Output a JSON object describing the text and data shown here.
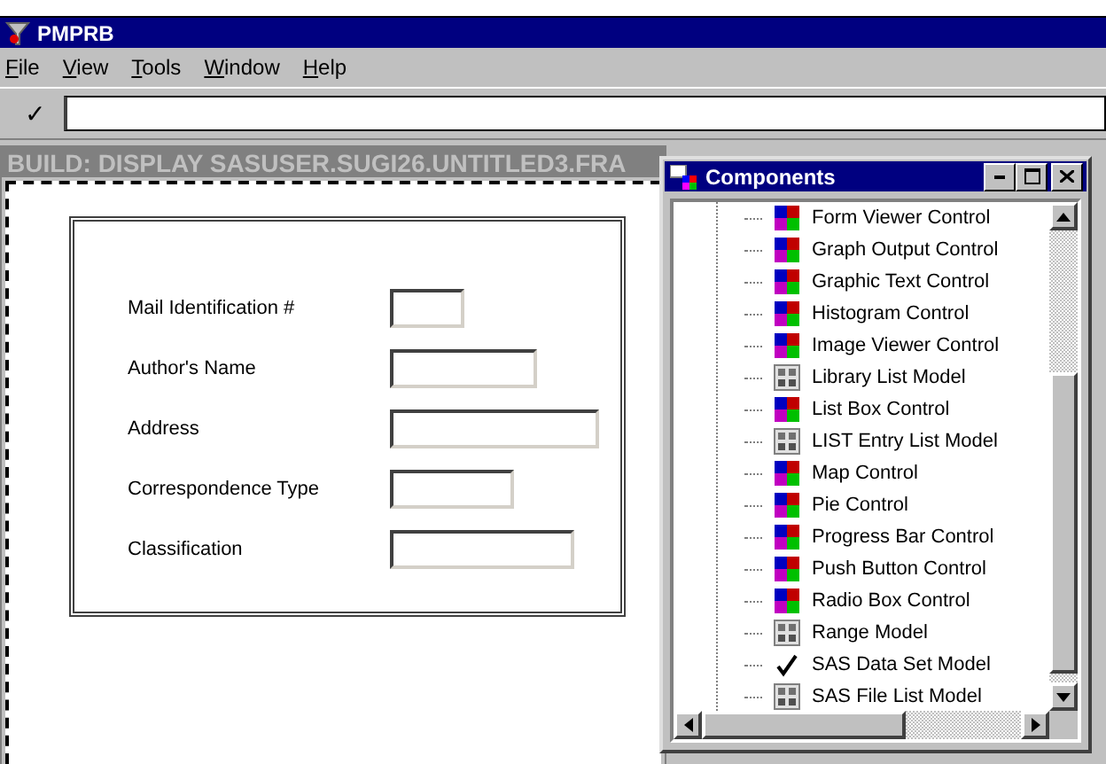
{
  "window": {
    "title": "PMPRB"
  },
  "menu": [
    {
      "label": "File"
    },
    {
      "label": "View"
    },
    {
      "label": "Tools"
    },
    {
      "label": "Window"
    },
    {
      "label": "Help"
    }
  ],
  "toolbar": {
    "check": "✓"
  },
  "build_window": {
    "title": "BUILD: DISPLAY SASUSER.SUGI26.UNTITLED3.FRA",
    "active": false,
    "fields": [
      {
        "label": "Mail Identification #"
      },
      {
        "label": "Author's Name"
      },
      {
        "label": "Address"
      },
      {
        "label": "Correspondence Type"
      },
      {
        "label": "Classification"
      }
    ]
  },
  "components_window": {
    "title": "Components",
    "active": true,
    "items": [
      {
        "label": "Form Viewer Control",
        "kind": "control"
      },
      {
        "label": "Graph Output Control",
        "kind": "control"
      },
      {
        "label": "Graphic Text Control",
        "kind": "control"
      },
      {
        "label": "Histogram Control",
        "kind": "control"
      },
      {
        "label": "Image Viewer Control",
        "kind": "control"
      },
      {
        "label": "Library List Model",
        "kind": "model"
      },
      {
        "label": "List Box Control",
        "kind": "control"
      },
      {
        "label": "LIST Entry List Model",
        "kind": "model"
      },
      {
        "label": "Map Control",
        "kind": "control"
      },
      {
        "label": "Pie Control",
        "kind": "control"
      },
      {
        "label": "Progress Bar Control",
        "kind": "control"
      },
      {
        "label": "Push Button Control",
        "kind": "control"
      },
      {
        "label": "Radio Box Control",
        "kind": "control"
      },
      {
        "label": "Range Model",
        "kind": "model"
      },
      {
        "label": "SAS Data Set Model",
        "kind": "check"
      },
      {
        "label": "SAS File List Model",
        "kind": "model"
      }
    ]
  }
}
